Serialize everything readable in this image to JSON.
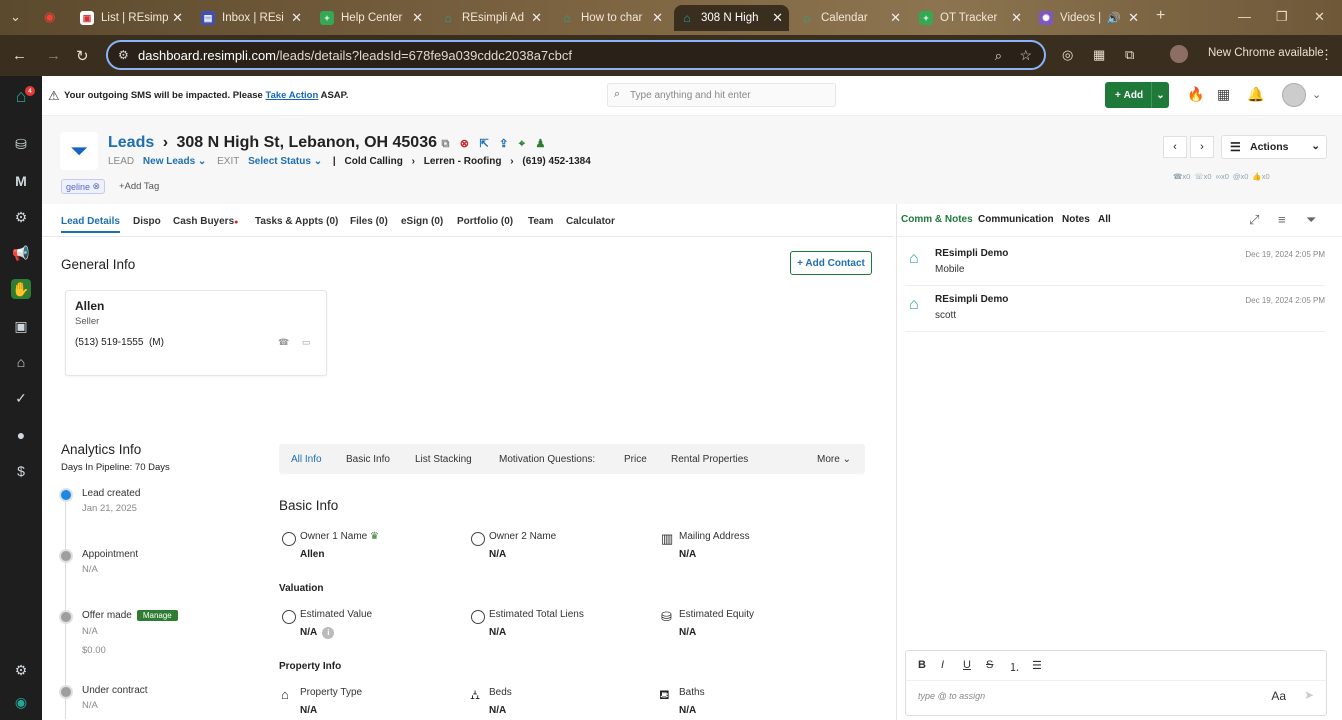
{
  "browser": {
    "tabs": [
      {
        "title": "List | REsimp",
        "fav": "#fff",
        "favtext": "L"
      },
      {
        "title": "Inbox | REsi",
        "fav": "#3f51b5",
        "favtext": "I"
      },
      {
        "title": "Help Center",
        "fav": "#34a853",
        "favtext": "+"
      },
      {
        "title": "REsimpli Ad",
        "fav": "#26a69a",
        "favtext": "R"
      },
      {
        "title": "How to char",
        "fav": "#26a69a",
        "favtext": "R"
      },
      {
        "title": "308 N High",
        "fav": "#26a69a",
        "favtext": "R"
      },
      {
        "title": "Calendar",
        "fav": "#26a69a",
        "favtext": "R"
      },
      {
        "title": "OT Tracker",
        "fav": "#34a853",
        "favtext": "+"
      },
      {
        "title": "Videos |",
        "fav": "#7e57c2",
        "favtext": "V"
      }
    ],
    "url_host": "dashboard.resimpli.com",
    "url_path": "/leads/details?leadsId=678fe9a039cddc2038a7cbcf",
    "update_label": "New Chrome available"
  },
  "alert": {
    "prefix": "Your outgoing",
    "sms": "SMS",
    "middle": "will be impacted. Please",
    "link": "Take Action",
    "suffix": "ASAP."
  },
  "search": {
    "placeholder": "Type anything and hit enter"
  },
  "add_button": "Add",
  "lead": {
    "section": "Leads",
    "address": "308 N High St, Lebanon, OH 45036",
    "lead_label": "LEAD",
    "status": "New Leads",
    "exit_label": "EXIT",
    "exit_status": "Select Status",
    "source": "Cold Calling",
    "campaign": "Lerren - Roofing",
    "phone": "(619) 452-1384",
    "tag": "geline",
    "add_tag": "+Add Tag",
    "actions": "Actions",
    "counters": [
      "x0",
      "x0",
      "x0",
      "x0",
      "x0"
    ]
  },
  "tabs": [
    "Lead Details",
    "Dispo",
    "Cash Buyers",
    "Tasks & Appts (0)",
    "Files (0)",
    "eSign (0)",
    "Portfolio (0)",
    "Team",
    "Calculator"
  ],
  "general": {
    "title": "General Info",
    "add_contact": "+ Add Contact",
    "contact": {
      "name": "Allen",
      "role": "Seller",
      "phone": "(513) 519-1555",
      "phone_type": "(M)"
    }
  },
  "analytics": {
    "title": "Analytics Info",
    "pipeline": "Days In Pipeline: 70 Days",
    "timeline": [
      {
        "label": "Lead created",
        "value": "Jan 21, 2025",
        "done": true
      },
      {
        "label": "Appointment",
        "value": "N/A",
        "done": false
      },
      {
        "label": "Offer made",
        "badge": "Manage",
        "value": "N/A",
        "extra": "$0.00",
        "done": false
      },
      {
        "label": "Under contract",
        "value": "N/A",
        "done": false
      }
    ]
  },
  "info_tabs": [
    "All Info",
    "Basic Info",
    "List Stacking",
    "Motivation Questions:",
    "Price",
    "Rental Properties"
  ],
  "info_more": "More",
  "basic": {
    "title": "Basic Info",
    "owner1_label": "Owner 1 Name",
    "owner1": "Allen",
    "owner2_label": "Owner 2 Name",
    "owner2": "N/A",
    "mailing_label": "Mailing Address",
    "mailing": "N/A",
    "valuation_title": "Valuation",
    "est_value_label": "Estimated Value",
    "est_value": "N/A",
    "liens_label": "Estimated Total Liens",
    "liens": "N/A",
    "equity_label": "Estimated Equity",
    "equity": "N/A",
    "property_title": "Property Info",
    "ptype_label": "Property Type",
    "ptype": "N/A",
    "beds_label": "Beds",
    "beds": "N/A",
    "baths_label": "Baths",
    "baths": "N/A"
  },
  "right": {
    "tabs": [
      "Comm & Notes",
      "Communication",
      "Notes",
      "All"
    ],
    "notes": [
      {
        "who": "REsimpli Demo",
        "body": "Mobile",
        "when": "Dec 19, 2024 2:05 PM"
      },
      {
        "who": "REsimpli Demo",
        "body": "scott",
        "when": "Dec 19, 2024 2:05 PM"
      }
    ],
    "composer_placeholder": "type @ to assign",
    "composer_font": "Aa"
  },
  "colors": {
    "brand_green": "#1f7a3a",
    "link_blue": "#1f6fb2"
  }
}
